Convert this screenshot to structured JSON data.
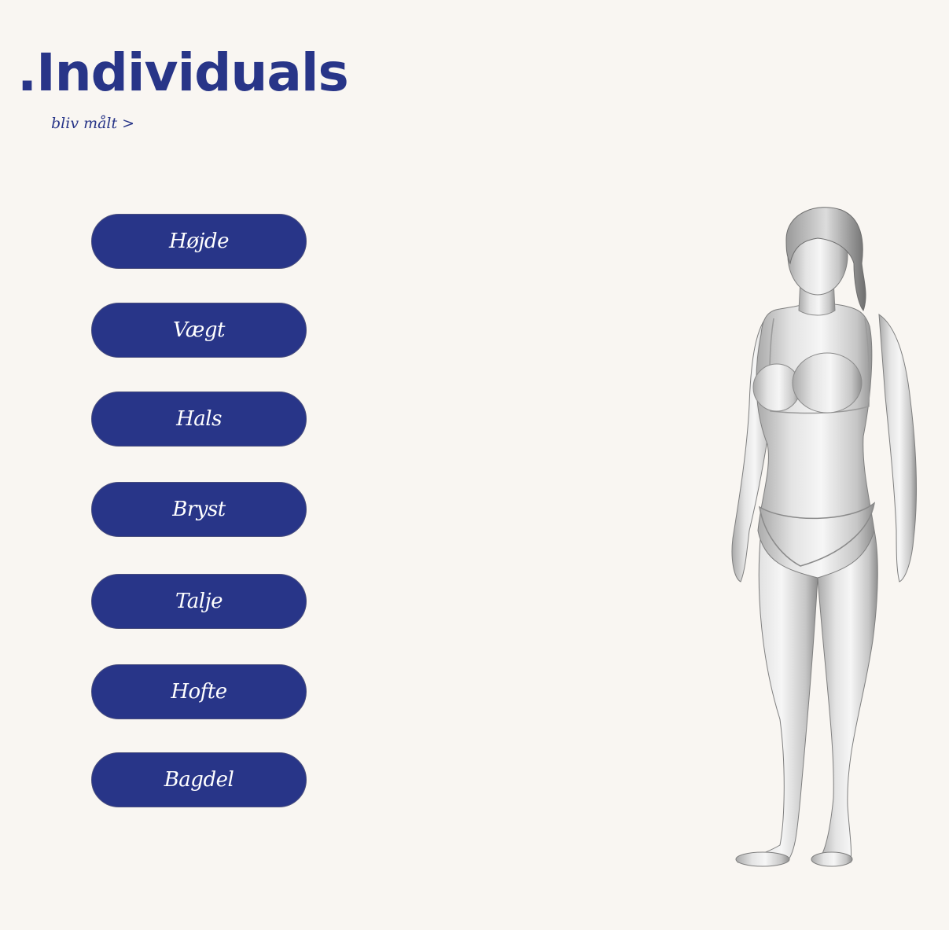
{
  "header": {
    "logo": ".Individuals",
    "subtitle_link": "bliv målt >"
  },
  "measurements": {
    "buttons": [
      {
        "label": "Højde"
      },
      {
        "label": "Vægt"
      },
      {
        "label": "Hals"
      },
      {
        "label": "Bryst"
      },
      {
        "label": "Talje"
      },
      {
        "label": "Hofte"
      },
      {
        "label": "Bagdel"
      }
    ]
  },
  "colors": {
    "background": "#f9f6f2",
    "brand_blue": "#283588",
    "button_text": "#ffffff"
  },
  "figure": {
    "icon": "female-body-model"
  }
}
